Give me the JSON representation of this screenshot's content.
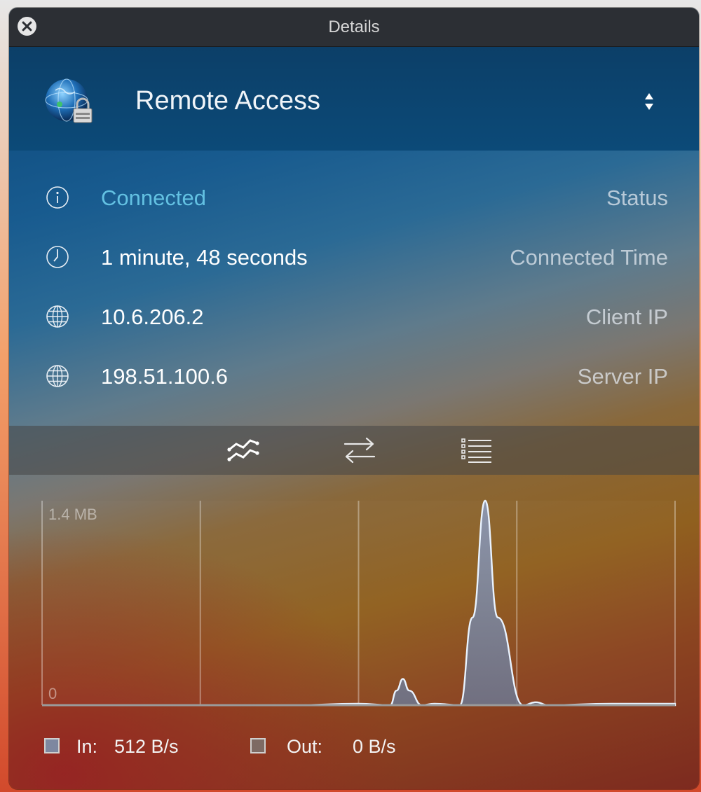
{
  "window": {
    "title": "Details"
  },
  "header": {
    "connection_name": "Remote Access",
    "logo_icon": "vpn-globe-lock-icon"
  },
  "info_rows": [
    {
      "icon": "info-icon",
      "value": "Connected",
      "label": "Status"
    },
    {
      "icon": "clock-icon",
      "value": "1 minute, 48 seconds",
      "label": "Connected Time"
    },
    {
      "icon": "globe-icon",
      "value": "10.6.206.2",
      "label": "Client IP"
    },
    {
      "icon": "globe-icon",
      "value": "198.51.100.6",
      "label": "Server IP"
    }
  ],
  "tabs": [
    {
      "name": "graph-tab",
      "icon": "traffic-graph-icon",
      "selected": true
    },
    {
      "name": "transfer-tab",
      "icon": "arrows-swap-icon",
      "selected": false
    },
    {
      "name": "log-tab",
      "icon": "list-icon",
      "selected": false
    }
  ],
  "colors": {
    "status_accent": "#63c1e2",
    "in_series": "#7e87a0",
    "out_series": "#7e6a64"
  },
  "chart_data": {
    "type": "area",
    "ymax_label": "1.4 MB",
    "ymin_label": "0",
    "ylim": [
      0,
      1.4
    ],
    "yunit": "MB",
    "series": [
      {
        "name": "In",
        "x": [
          0,
          10,
          20,
          30,
          40,
          50,
          55,
          56,
          57,
          58,
          60,
          62,
          66,
          68,
          70,
          72,
          76,
          78,
          80,
          90,
          100
        ],
        "values": [
          0,
          0,
          0,
          0,
          0,
          0.01,
          0,
          0.1,
          0.18,
          0.1,
          0,
          0.01,
          0,
          0.6,
          1.4,
          0.6,
          0,
          0.02,
          0,
          0.01,
          0.01
        ]
      },
      {
        "name": "Out",
        "x": [
          0,
          100
        ],
        "values": [
          0,
          0
        ]
      }
    ]
  },
  "legend": {
    "in_label": "In:",
    "in_value": "512 B/s",
    "out_label": "Out:",
    "out_value": "0 B/s"
  }
}
